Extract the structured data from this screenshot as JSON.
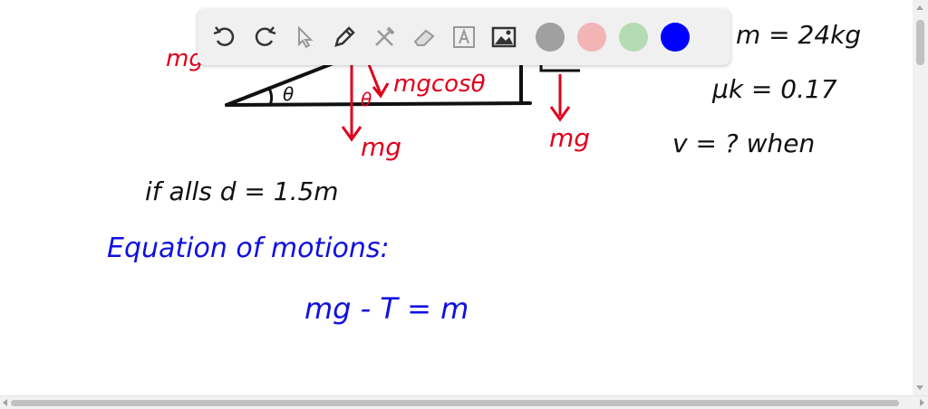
{
  "canvas": {
    "red_mg_partial": "mg",
    "theta_small": "θ",
    "theta_red": "θ",
    "mgcos": "mgcosθ",
    "mg_left": "mg",
    "mg_right": "mg",
    "mass": "m = 24kg",
    "mu": "μk = 0.17",
    "velocity": "v = ?  when",
    "falls": "if alls d = 1.5m",
    "equation_heading": "Equation of motions:",
    "equation": "mg - T = m"
  },
  "toolbar": {
    "tools": [
      "undo-icon",
      "redo-icon",
      "select-icon",
      "pen-icon",
      "tools-icon",
      "eraser-icon",
      "text-icon",
      "image-icon"
    ],
    "colors": [
      "#a0a0a0",
      "#f2b4b4",
      "#b4dcb4",
      "#0000ff"
    ]
  }
}
